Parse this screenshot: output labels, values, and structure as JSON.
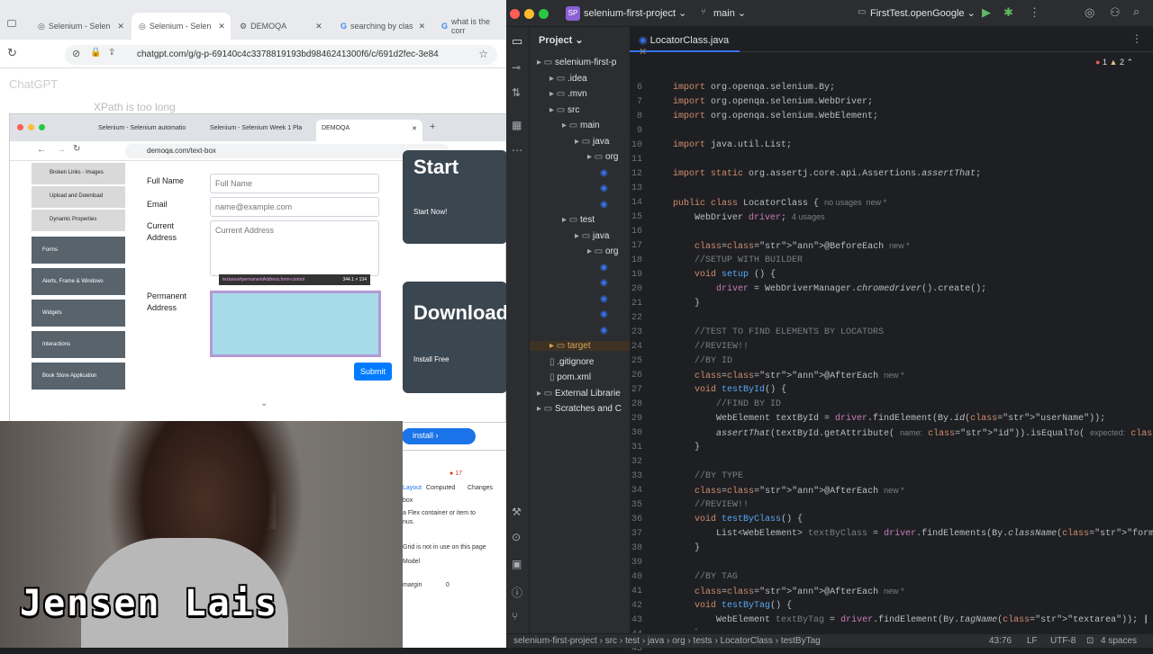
{
  "browser": {
    "tabs": [
      {
        "label": "Selenium - Selen"
      },
      {
        "label": "Selenium - Selen"
      },
      {
        "label": "DEMOQA"
      },
      {
        "label": "searching by clas"
      },
      {
        "label": "what is the corr"
      }
    ],
    "url": "chatgpt.com/g/g-p-69140c4c3378819193bd9846241300f6/c/691d2fec-3e84",
    "chatgpt_header": "ChatGPT",
    "bg_text": "XPath is too long",
    "inner": {
      "tabs": [
        {
          "label": "Selenium - Selenium automatio"
        },
        {
          "label": "Selenium - Selenium Week 1 Pla"
        },
        {
          "label": "DEMOQA"
        }
      ],
      "url": "demoqa.com/text-box",
      "sidebar_items": [
        "Broken Links - Images",
        "Upload and Download",
        "Dynamic Properties"
      ],
      "sidebar_groups": [
        "Forms",
        "Alerts, Frame & Windows",
        "Widgets",
        "Interactions",
        "Book Store Application"
      ],
      "labels": {
        "full_name": "Full Name",
        "email": "Email",
        "current": "Current",
        "address": "Address",
        "permanent": "Permanent",
        "address2": "Address"
      },
      "placeholders": {
        "full_name": "Full Name",
        "email": "name@example.com",
        "current_address": "Current Address"
      },
      "tooltip": "textarea#permanentAddress.form-control",
      "tooltip_size": "344.1 × 134",
      "submit": "Submit",
      "ads": {
        "start": "Start",
        "start_now": "Start Now!",
        "download": "Download",
        "install_free": "Install Free",
        "install": "install"
      }
    },
    "devtools": {
      "tabs": [
        "Layout",
        "Computed",
        "Changes"
      ],
      "count": "17",
      "line1": "a Flex container or item to",
      "line2": "nus.",
      "line3": "Grid is not in use on this page",
      "box": "box",
      "model": "Model",
      "margin": "margin",
      "zero": "0"
    }
  },
  "webcam": {
    "name": "Jensen Lais"
  },
  "ide": {
    "project_badge": "SP",
    "project": "selenium-first-project",
    "branch": "main",
    "run_config": "FirstTest.openGoogle",
    "project_label": "Project",
    "tab": "LocatorClass.java",
    "warnings": {
      "errors": "1",
      "warnings": "2"
    },
    "tree": [
      {
        "label": "selenium-first-p",
        "depth": 0
      },
      {
        "label": ".idea",
        "depth": 1
      },
      {
        "label": ".mvn",
        "depth": 1
      },
      {
        "label": "src",
        "depth": 1
      },
      {
        "label": "main",
        "depth": 2
      },
      {
        "label": "java",
        "depth": 3
      },
      {
        "label": "org",
        "depth": 4
      },
      {
        "label": "",
        "depth": 5
      },
      {
        "label": "",
        "depth": 5
      },
      {
        "label": "",
        "depth": 5
      },
      {
        "label": "test",
        "depth": 2
      },
      {
        "label": "java",
        "depth": 3
      },
      {
        "label": "org",
        "depth": 4
      },
      {
        "label": "",
        "depth": 5
      },
      {
        "label": "",
        "depth": 5
      },
      {
        "label": "",
        "depth": 5
      },
      {
        "label": "",
        "depth": 5
      },
      {
        "label": "",
        "depth": 5
      },
      {
        "label": "target",
        "depth": 1
      },
      {
        "label": ".gitignore",
        "depth": 1
      },
      {
        "label": "pom.xml",
        "depth": 1
      },
      {
        "label": "External Librarie",
        "depth": 0
      },
      {
        "label": "Scratches and C",
        "depth": 0
      }
    ],
    "code_lines": [
      {
        "n": "6",
        "t": "import org.openqa.selenium.By;"
      },
      {
        "n": "7",
        "t": "import org.openqa.selenium.WebDriver;"
      },
      {
        "n": "8",
        "t": "import org.openqa.selenium.WebElement;"
      },
      {
        "n": "9",
        "t": ""
      },
      {
        "n": "10",
        "t": "import java.util.List;"
      },
      {
        "n": "11",
        "t": ""
      },
      {
        "n": "12",
        "t": "import static org.assertj.core.api.Assertions.assertThat;"
      },
      {
        "n": "13",
        "t": ""
      },
      {
        "n": "14",
        "t": "public class LocatorClass {"
      },
      {
        "n": "15",
        "t": "    WebDriver driver;"
      },
      {
        "n": "16",
        "t": ""
      },
      {
        "n": "17",
        "t": "    @BeforeEach"
      },
      {
        "n": "18",
        "t": "    //SETUP WITH BUILDER"
      },
      {
        "n": "19",
        "t": "    void setup () {"
      },
      {
        "n": "20",
        "t": "        driver = WebDriverManager.chromedriver().create();"
      },
      {
        "n": "21",
        "t": "    }"
      },
      {
        "n": "22",
        "t": ""
      },
      {
        "n": "23",
        "t": "    //TEST TO FIND ELEMENTS BY LOCATORS"
      },
      {
        "n": "24",
        "t": "    //REVIEW!!"
      },
      {
        "n": "25",
        "t": "    //BY ID"
      },
      {
        "n": "26",
        "t": "    @AfterEach"
      },
      {
        "n": "27",
        "t": "    void testById() {"
      },
      {
        "n": "28",
        "t": "        //FIND BY ID"
      },
      {
        "n": "29",
        "t": "        WebElement textById = driver.findElement(By.id(\"userName\"));"
      },
      {
        "n": "30",
        "t": "        assertThat(textById.getAttribute( \"id\")).isEqualTo( \"userName\");"
      },
      {
        "n": "31",
        "t": "    }"
      },
      {
        "n": "32",
        "t": ""
      },
      {
        "n": "33",
        "t": "    //BY TYPE"
      },
      {
        "n": "34",
        "t": "    @AfterEach"
      },
      {
        "n": "35",
        "t": "    //REVIEW!!"
      },
      {
        "n": "36",
        "t": "    void testByClass() {"
      },
      {
        "n": "37",
        "t": "        List<WebElement> textByClass = driver.findElements(By.className(\"form-control\"));"
      },
      {
        "n": "38",
        "t": "    }"
      },
      {
        "n": "39",
        "t": ""
      },
      {
        "n": "40",
        "t": "    //BY TAG"
      },
      {
        "n": "41",
        "t": "    @AfterEach"
      },
      {
        "n": "42",
        "t": "    void testByTag() {"
      },
      {
        "n": "43",
        "t": "        WebElement textByTag = driver.findElement(By.tagName(\"textarea\"));"
      },
      {
        "n": "44",
        "t": "    }"
      },
      {
        "n": "45",
        "t": "}"
      }
    ],
    "hints": {
      "no_usages": "no usages",
      "new": "new *",
      "usages4": "4 usages",
      "name": "name:",
      "expected": "expected:"
    },
    "breadcrumb": [
      "selenium-first-project",
      "src",
      "test",
      "java",
      "org",
      "tests",
      "LocatorClass",
      "testByTag"
    ],
    "status": {
      "pos": "43:76",
      "lf": "LF",
      "enc": "UTF-8",
      "indent": "4 spaces"
    }
  }
}
